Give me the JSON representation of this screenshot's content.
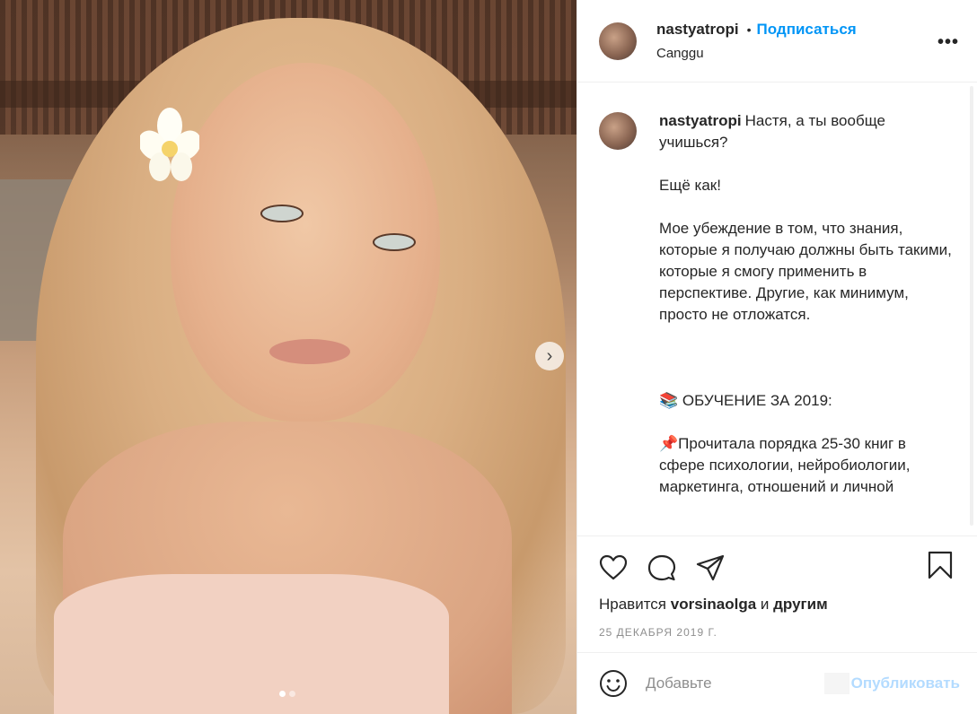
{
  "post": {
    "username": "nastyatropi",
    "follow_label": "Подписаться",
    "location": "Canggu",
    "more_label": "•••"
  },
  "caption": {
    "username": "nastyatropi",
    "text": "Настя, а ты вообще учишься?\n\nЕщё как!\n\nМое убеждение в том, что знания, которые я получаю должны быть такими, которые я смогу применить в перспективе. Другие, как минимум, просто не отложатся.\n\n\n\n📚 ОБУЧЕНИЕ ЗА 2019:\n\n📌Прочитала порядка 25-30 книг в сфере психологии, нейробиологии, маркетинга, отношений и личной"
  },
  "likes": {
    "prefix": "Нравится",
    "user": "vorsinaolga",
    "conjunction": "и",
    "others": "другим"
  },
  "date": "25 ДЕКАБРЯ 2019 Г.",
  "comment": {
    "placeholder": "Добавьте",
    "publish_label": "Опубликовать"
  },
  "carousel": {
    "next_glyph": "›",
    "slide_count": 2,
    "active_index": 0
  },
  "colors": {
    "accent": "#0095f6",
    "publish_disabled": "#b3dbff",
    "muted": "#8e8e8e",
    "text": "#262626"
  }
}
